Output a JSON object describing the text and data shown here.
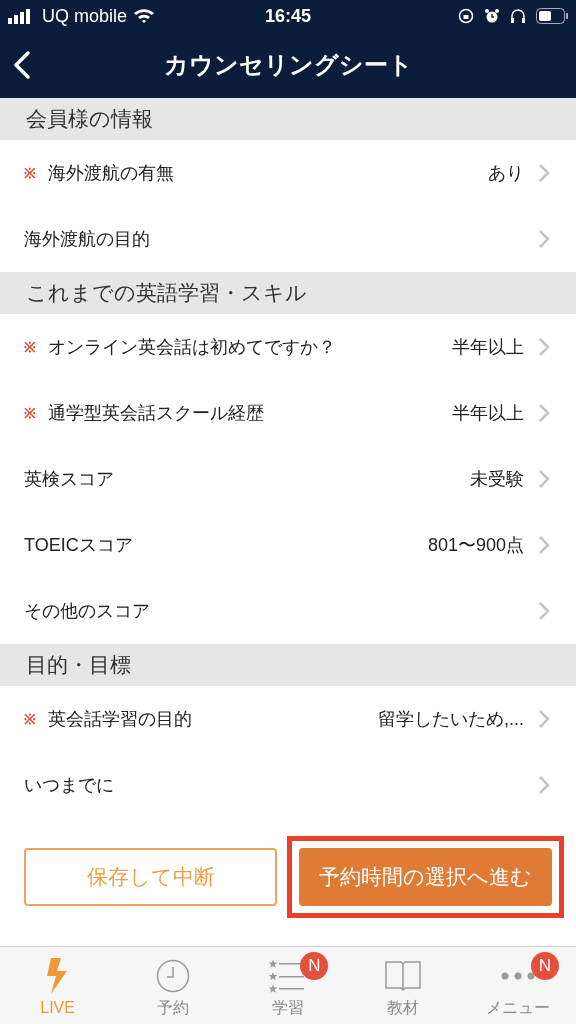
{
  "status_bar": {
    "carrier": "UQ mobile",
    "time": "16:45"
  },
  "nav": {
    "title": "カウンセリングシート"
  },
  "sections": [
    {
      "title": "会員様の情報",
      "rows": [
        {
          "label": "海外渡航の有無",
          "required": true,
          "value": "あり"
        },
        {
          "label": "海外渡航の目的",
          "required": false
        }
      ]
    },
    {
      "title": "これまでの英語学習・スキル",
      "rows": [
        {
          "label": "オンライン英会話は初めてですか？",
          "required": true,
          "value": "半年以上"
        },
        {
          "label": "通学型英会話スクール経歴",
          "required": true,
          "value": "半年以上"
        },
        {
          "label": "英検スコア",
          "required": false,
          "value": "未受験"
        },
        {
          "label": "TOEICスコア",
          "required": false,
          "value": "801〜900点"
        },
        {
          "label": "その他のスコア",
          "required": false
        }
      ]
    },
    {
      "title": "目的・目標",
      "rows": [
        {
          "label": "英会話学習の目的",
          "required": true,
          "value": "留学したいため,..."
        },
        {
          "label": "いつまでに",
          "required": false
        }
      ]
    }
  ],
  "required_mark": "※",
  "buttons": [
    {
      "label": "保存して中断",
      "kind": "outline",
      "highlighted": false
    },
    {
      "label": "予約時間の選択へ進む",
      "kind": "filled",
      "highlighted": true
    }
  ],
  "tabs": [
    {
      "label": "LIVE",
      "selected": true
    },
    {
      "label": "予約",
      "selected": false
    },
    {
      "label": "学習",
      "selected": false,
      "badge": "N"
    },
    {
      "label": "教材",
      "selected": false
    },
    {
      "label": "メニュー",
      "selected": false,
      "badge": "N"
    }
  ]
}
